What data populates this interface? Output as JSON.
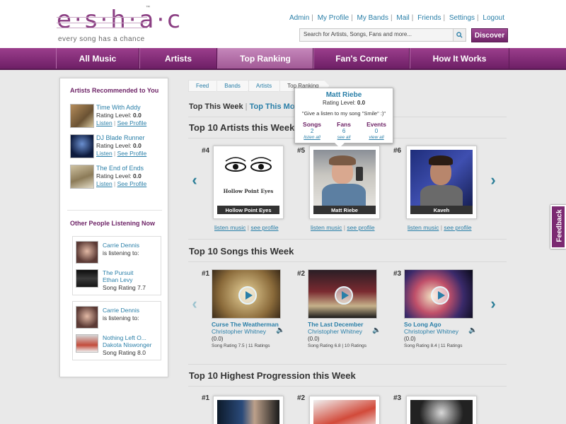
{
  "brand": {
    "logo_text": "e·s·h·a·c",
    "tagline": "every song has a chance",
    "tm": "™"
  },
  "top_links": [
    "Admin",
    "My Profile",
    "My Bands",
    "Mail",
    "Friends",
    "Settings",
    "Logout"
  ],
  "search": {
    "placeholder": "Search for Artists, Songs, Fans and more...",
    "button": "Discover"
  },
  "nav": [
    "All Music",
    "Artists",
    "Top Ranking",
    "Fan's Corner",
    "How It Works"
  ],
  "nav_active": "Top Ranking",
  "sidebar": {
    "rec_title": "Artists Recommended to You",
    "recommended": [
      {
        "name": "Time With Addy",
        "rating_label": "Rating Level:",
        "rating": "0.0",
        "listen": "Listen",
        "profile": "See Profile"
      },
      {
        "name": "DJ Blade Runner",
        "rating_label": "Rating Level:",
        "rating": "0.0",
        "listen": "Listen",
        "profile": "See Profile"
      },
      {
        "name": "The End of Ends",
        "rating_label": "Rating Level:",
        "rating": "0.0",
        "listen": "Listen",
        "profile": "See Profile"
      }
    ],
    "listen_title": "Other People Listening Now",
    "listening": [
      {
        "user": "Carrie Dennis",
        "action": "is listening to:",
        "song": "The Pursuit",
        "artist": "Ethan Levy",
        "rating": "Song Rating 7.7"
      },
      {
        "user": "Carrie Dennis",
        "action": "is listening to:",
        "song": "Nothing Left O...",
        "artist": "Dakota Niswonger",
        "rating": "Song Rating 8.0"
      }
    ]
  },
  "breadcrumbs": [
    "Feed",
    "Bands",
    "Artists",
    "Top Ranking"
  ],
  "period": {
    "week": "Top This Week",
    "month": "Top This Month",
    "sep": "|"
  },
  "sections": {
    "artists": "Top 10 Artists this Week",
    "songs": "Top 10 Songs this Week",
    "progression": "Top 10 Highest Progression this Week"
  },
  "artists": [
    {
      "rank": "#4",
      "name": "Hollow Point Eyes",
      "img_text": "Hollow Point Eyes",
      "listen": "listen music",
      "profile": "see profile"
    },
    {
      "rank": "#5",
      "name": "Matt Riebe",
      "listen": "listen music",
      "profile": "see profile"
    },
    {
      "rank": "#6",
      "name": "Kaveh",
      "listen": "listen music",
      "profile": "see profile"
    }
  ],
  "tooltip": {
    "name": "Matt Riebe",
    "rating_label": "Rating Level:",
    "rating": "0.0",
    "quote": "\"Give a listen to my song \"Smile\" :)\"",
    "stats": [
      {
        "label": "Songs",
        "value": "2",
        "link": "listen all"
      },
      {
        "label": "Fans",
        "value": "6",
        "link": "see all"
      },
      {
        "label": "Events",
        "value": "0",
        "link": "view all"
      }
    ]
  },
  "songs": [
    {
      "rank": "#1",
      "title": "Curse The Weatherman",
      "artist": "Christopher Whitney",
      "score": "(0.0)",
      "meta": "Song Rating 7.5 | 11 Ratings"
    },
    {
      "rank": "#2",
      "title": "The Last December",
      "artist": "Christopher Whitney",
      "score": "(0.0)",
      "meta": "Song Rating 6.8 | 10 Ratings"
    },
    {
      "rank": "#3",
      "title": "So Long Ago",
      "artist": "Christopher Whitney",
      "score": "(0.0)",
      "meta": "Song Rating 8.4 | 11 Ratings"
    }
  ],
  "progression": [
    {
      "rank": "#1"
    },
    {
      "rank": "#2"
    },
    {
      "rank": "#3"
    }
  ],
  "feedback": "Feedback",
  "colors": {
    "brand": "#7b2a72",
    "link": "#2a7fa8",
    "nav": "#8a3580"
  }
}
